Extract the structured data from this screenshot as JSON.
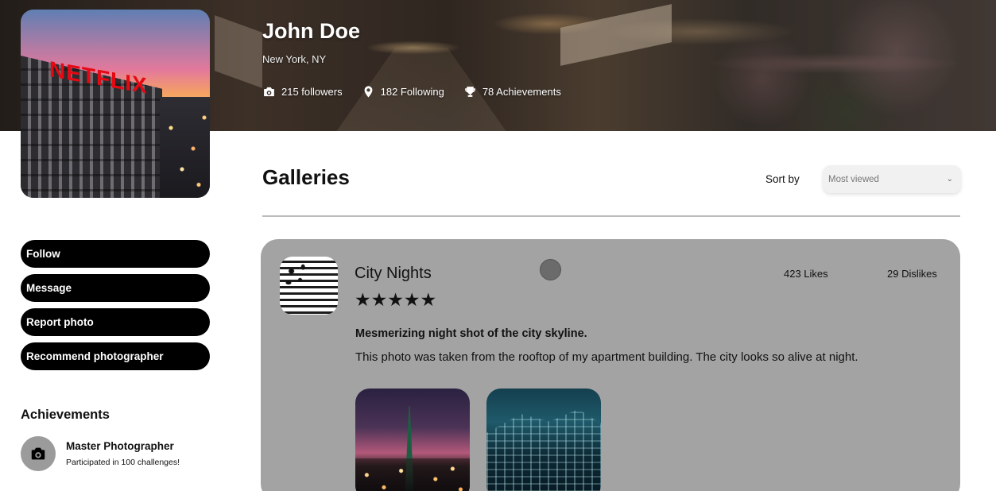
{
  "profile": {
    "name": "John Doe",
    "location": "New York, NY",
    "photo_sign": "NETFLIX",
    "stats": {
      "followers": "215 followers",
      "following": "182 Following",
      "achievements": "78 Achievements"
    }
  },
  "actions": {
    "follow": "Follow",
    "message": "Message",
    "report": "Report photo",
    "recommend": "Recommend photographer"
  },
  "achievements": {
    "heading": "Achievements",
    "items": [
      {
        "title": "Master Photographer",
        "subtitle": "Participated in 100 challenges!",
        "icon": "camera-icon"
      }
    ]
  },
  "galleries": {
    "title": "Galleries",
    "sort_label": "Sort by",
    "sort_value": "Most viewed",
    "items": [
      {
        "title": "City Nights",
        "rating": 5,
        "stars": "★★★★★",
        "likes": "423 Likes",
        "dislikes": "29 Dislikes",
        "subtitle": "Mesmerizing night shot of the city skyline.",
        "description": "This photo was taken from the rooftop of my apartment building. The city looks so alive at night."
      }
    ]
  },
  "colors": {
    "button_bg": "#000000",
    "card_bg": "#a3a3a3",
    "divider": "#bdbdbd"
  }
}
